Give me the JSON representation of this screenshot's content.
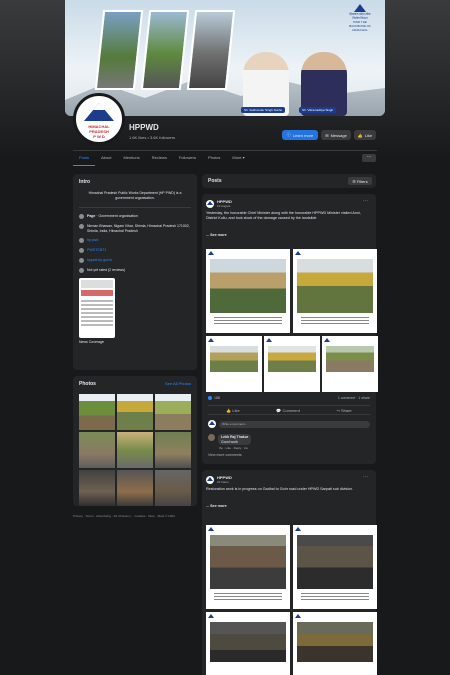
{
  "page": {
    "name": "HPPWD",
    "stats": "1.6K likes • 3.6K followers",
    "avatar_text_1": "HIMACHAL",
    "avatar_text_2": "PRADESH",
    "avatar_text_3": "P W D",
    "cover_logo_text": "हिमाचल प्रदेश लोक निर्माण विभाग",
    "cover_tagline": "PWD THE BACKBONE OF HIMACHAL",
    "cover_caption_1": "Sh. Sukhvinder Singh Sukhu",
    "cover_caption_2": "Sh. Vikramaditya Singh"
  },
  "buttons": {
    "learn_more": "Learn more",
    "message": "Message",
    "like": "Like"
  },
  "tabs": [
    "Posts",
    "About",
    "Mentions",
    "Reviews",
    "Followers",
    "Photos",
    "More ▾"
  ],
  "intro": {
    "title": "Intro",
    "description": "Himachal Pradesh Public Works Department (HP PWD) is a government organisation.",
    "page_type_label": "Page",
    "page_type": " · Government organisation",
    "address": "Nirman Bhawan, Nigam Vihar, Shimla, Himachal Pradesh 171002, Shimla, India, Himachal Pradesh",
    "email": "hp.pwd",
    "twitter": "PWDTCBT1",
    "website": "hppwd.hp.gov.in",
    "rating": "Not yet rated (2 reviews)",
    "news_label": "News Coverage"
  },
  "photos": {
    "title": "Photos",
    "see_all": "See All Photos"
  },
  "footer": "Privacy · Terms · Advertising · Ad Choices ▷ · Cookies · More · Meta © 2023",
  "posts": {
    "title": "Posts",
    "filters": "Filters",
    "p1": {
      "author": "HPPWD",
      "time": "19 August ·",
      "text": "Yesterday, the honorable Chief Minister along with the honorable HPPWD Minister visited Anni, District Kullu, and took stock of the damage caused by the landslide",
      "see_more": "... See more",
      "reactions": "188",
      "comments": "1 comment · 1 share",
      "like": "Like",
      "comment": "Comment",
      "share": "Share",
      "comment_placeholder": "Write a comment...",
      "commenter": "Lekh Raj Thakur",
      "comment_text": "Good work",
      "comment_meta": "3w · Like · Reply · 1w",
      "view_more": "View more comments"
    },
    "p2": {
      "author": "HPPWD",
      "time": "21 hours ·",
      "text": "Restoration work is in progress on Gadhal to Gohr road under HPWD Sarpati sub division.",
      "see_more": "... See more"
    }
  },
  "colors": {
    "background": "#18191a",
    "card": "#242526",
    "accent": "#2d88ff",
    "primary_button": "#2374e1"
  }
}
